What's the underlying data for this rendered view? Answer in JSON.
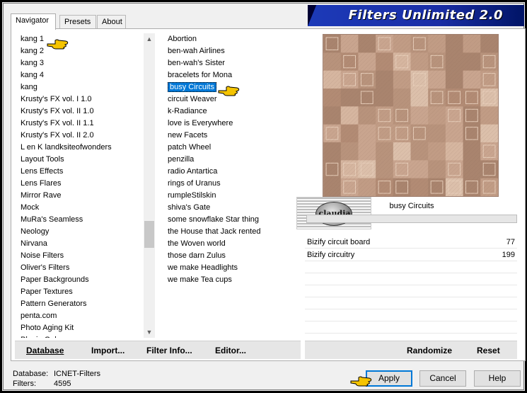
{
  "window": {
    "title": "Filters Unlimited 2.0"
  },
  "tabs": [
    {
      "label": "Navigator"
    },
    {
      "label": "Presets"
    },
    {
      "label": "About"
    }
  ],
  "categories": [
    "kang 1",
    "kang 2",
    "kang 3",
    "kang 4",
    "kang",
    "Krusty's FX vol. I 1.0",
    "Krusty's FX vol. II 1.0",
    "Krusty's FX vol. II 1.1",
    "Krusty's FX vol. II 2.0",
    "L en K landksiteofwonders",
    "Layout Tools",
    "Lens Effects",
    "Lens Flares",
    "Mirror Rave",
    "Mock",
    "MuRa's Seamless",
    "Neology",
    "Nirvana",
    "Noise Filters",
    "Oliver's Filters",
    "Paper Backgrounds",
    "Paper Textures",
    "Pattern Generators",
    "penta.com",
    "Photo Aging Kit",
    "Plugin Galaxy"
  ],
  "filters": [
    "Abortion",
    "ben-wah Airlines",
    "ben-wah's Sister",
    "bracelets for Mona",
    "busy Circuits",
    "circuit Weaver",
    "k-Radiance",
    "love is Everywhere",
    "new Facets",
    "patch Wheel",
    "penzilla",
    "radio Antartica",
    "rings of Uranus",
    "rumpleStilskin",
    "shiva's Gate",
    "some snowflake Star thing",
    "the House that Jack rented",
    "the Woven world",
    "those darn Zulus",
    "we make Headlights",
    "we make Tea cups"
  ],
  "selected_filter_index": 4,
  "preview": {
    "filter_name": "busy Circuits",
    "watermark": "claudia"
  },
  "params": [
    {
      "name": "Bizify circuit board",
      "value": "77"
    },
    {
      "name": "Bizify circuitry",
      "value": "199"
    }
  ],
  "left_toolbar": {
    "database": "Database",
    "import": "Import...",
    "filter_info": "Filter Info...",
    "editor": "Editor..."
  },
  "right_toolbar": {
    "randomize": "Randomize",
    "reset": "Reset"
  },
  "footer": {
    "database_label": "Database:",
    "database_value": "ICNET-Filters",
    "filters_label": "Filters:",
    "filters_value": "4595"
  },
  "buttons": {
    "apply": "Apply",
    "cancel": "Cancel",
    "help": "Help"
  },
  "colors": {
    "selection": "#0078d7",
    "header_blue": "#1c3ab8",
    "pointer_hand": "#f5c400"
  }
}
